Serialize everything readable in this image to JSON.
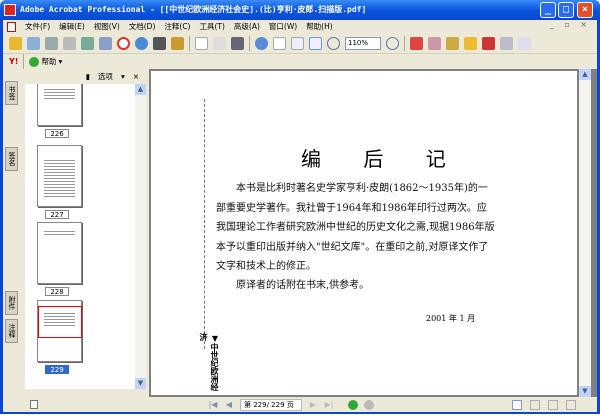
{
  "window": {
    "title": "Adobe Acrobat Professional - [[中世纪欧洲经济社会史].(比)亨利·皮郎.扫描版.pdf]",
    "min": "_",
    "max": "□",
    "close": "×"
  },
  "menu": [
    "文件(F)",
    "编辑(E)",
    "视图(V)",
    "文档(D)",
    "注释(C)",
    "工具(T)",
    "高级(A)",
    "窗口(W)",
    "帮助(H)"
  ],
  "mdi_controls": "_ ▫ ×",
  "toolbar": {
    "zoom": "110%",
    "help": "帮助",
    "yahoo": "Y!"
  },
  "left_tabs": [
    "书签",
    "签名",
    "附件",
    "注释"
  ],
  "panel": {
    "options": "选项",
    "close": "×"
  },
  "thumbnails": [
    {
      "label": "226"
    },
    {
      "label": "227"
    },
    {
      "label": "228"
    },
    {
      "label": "229",
      "selected": true
    }
  ],
  "document": {
    "heading": "编 后 记",
    "paragraphs": [
      "本书是比利时著名史学家亨利·皮朗(1862～1935年)的一部重要史学著作。我社曾于1964年和1986年印行过两次。应我国理论工作者研究欧洲中世纪的历史文化之需,现据1986年版本予以重印出版并纳入\"世纪文库\"。在重印之前,对原译文作了文字和技术上的修正。",
      "原译者的话附在书末,供参考。"
    ],
    "date": "2001 年 1 月",
    "spine_text": "▼中世纪欧洲经济"
  },
  "status": {
    "page_display": "第 229/ 229 页",
    "current_page": 229,
    "total_pages": 229
  }
}
